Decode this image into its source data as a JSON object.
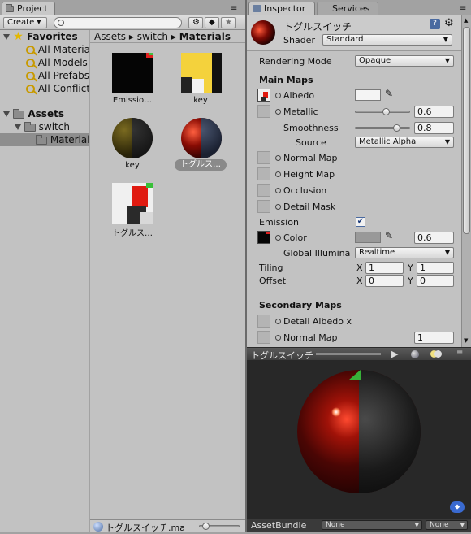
{
  "project": {
    "tab_label": "Project",
    "create_label": "Create ▾",
    "favorites_label": "Favorites",
    "favorites": [
      "All Materia",
      "All Models",
      "All Prefabs",
      "All Conflict"
    ],
    "assets_label": "Assets",
    "folders": [
      "switch",
      "Materials"
    ],
    "breadcrumb": [
      "Assets",
      "switch",
      "Materials"
    ],
    "items": [
      "Emissio…",
      "key",
      "key",
      "トグルス…",
      "トグルス…"
    ],
    "status_file": "トグルスイッチ.ma"
  },
  "inspector": {
    "tab_label": "Inspector",
    "services_tab": "Services",
    "material_name": "トグルスイッチ",
    "shader_label": "Shader",
    "shader_value": "Standard",
    "rendering_mode_label": "Rendering Mode",
    "rendering_mode_value": "Opaque",
    "main_maps_label": "Main Maps",
    "albedo_label": "Albedo",
    "metallic_label": "Metallic",
    "metallic_value": "0.6",
    "smoothness_label": "Smoothness",
    "smoothness_value": "0.8",
    "source_label": "Source",
    "source_value": "Metallic Alpha",
    "normal_map_label": "Normal Map",
    "height_map_label": "Height Map",
    "occlusion_label": "Occlusion",
    "detail_mask_label": "Detail Mask",
    "emission_label": "Emission",
    "color_label": "Color",
    "color_value": "0.6",
    "gi_label": "Global Illumina",
    "gi_value": "Realtime",
    "tiling_label": "Tiling",
    "offset_label": "Offset",
    "x_label": "X",
    "y_label": "Y",
    "tiling_x": "1",
    "tiling_y": "1",
    "offset_x": "0",
    "offset_y": "0",
    "secondary_maps_label": "Secondary Maps",
    "detail_albedo_label": "Detail Albedo x",
    "sec_normal_map_label": "Normal Map",
    "sec_normal_value": "1"
  },
  "preview": {
    "title": "トグルスイッチ",
    "assetbundle_label": "AssetBundle",
    "assetbundle_value": "None",
    "variant_value": "None"
  },
  "colors": {
    "panel": "#c2c2c2",
    "selection": "#8e8e8e",
    "preview_bg": "#282828",
    "accent_red": "#d42010"
  }
}
